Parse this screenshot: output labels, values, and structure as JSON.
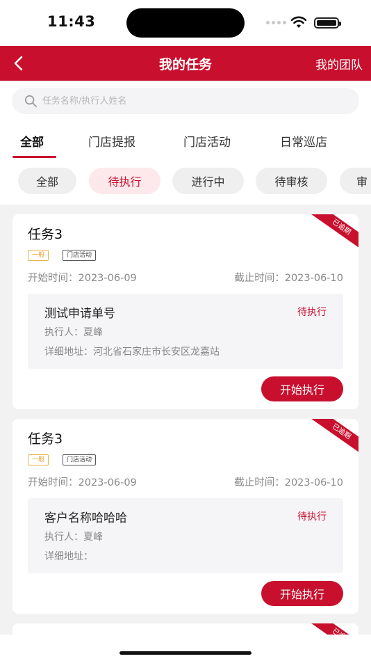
{
  "status_bar": {
    "time": "11:43"
  },
  "nav": {
    "title": "我的任务",
    "right_link": "我的团队"
  },
  "search": {
    "placeholder": "任务名称/执行人姓名",
    "value": ""
  },
  "tabs": [
    {
      "label": "全部",
      "active": true
    },
    {
      "label": "门店提报",
      "active": false
    },
    {
      "label": "门店活动",
      "active": false
    },
    {
      "label": "日常巡店",
      "active": false
    }
  ],
  "filters": [
    {
      "label": "全部",
      "active": false
    },
    {
      "label": "待执行",
      "active": true
    },
    {
      "label": "进行中",
      "active": false
    },
    {
      "label": "待审核",
      "active": false
    },
    {
      "label": "审",
      "active": false
    }
  ],
  "tasks": [
    {
      "title": "任务3",
      "ribbon": "已逾期",
      "level_tag": "一般",
      "type_tag": "门店活动",
      "start_time": "开始时间：2023-06-09",
      "end_time": "截止时间：2023-06-10",
      "detail_title": "测试申请单号",
      "status": "待执行",
      "executor": "执行人：夏峰",
      "address": "详细地址：河北省石家庄市长安区龙嘉站",
      "action": "开始执行"
    },
    {
      "title": "任务3",
      "ribbon": "已逾期",
      "level_tag": "一般",
      "type_tag": "门店活动",
      "start_time": "开始时间：2023-06-09",
      "end_time": "截止时间：2023-06-10",
      "detail_title": "客户名称哈哈哈",
      "status": "待执行",
      "executor": "执行人：夏峰",
      "address": "详细地址：",
      "action": "开始执行"
    },
    {
      "ribbon": "已逾期"
    }
  ],
  "colors": {
    "brand": "#c8102e",
    "chip_active_bg": "#fde8eb",
    "tag_level": "#e8a02a"
  }
}
